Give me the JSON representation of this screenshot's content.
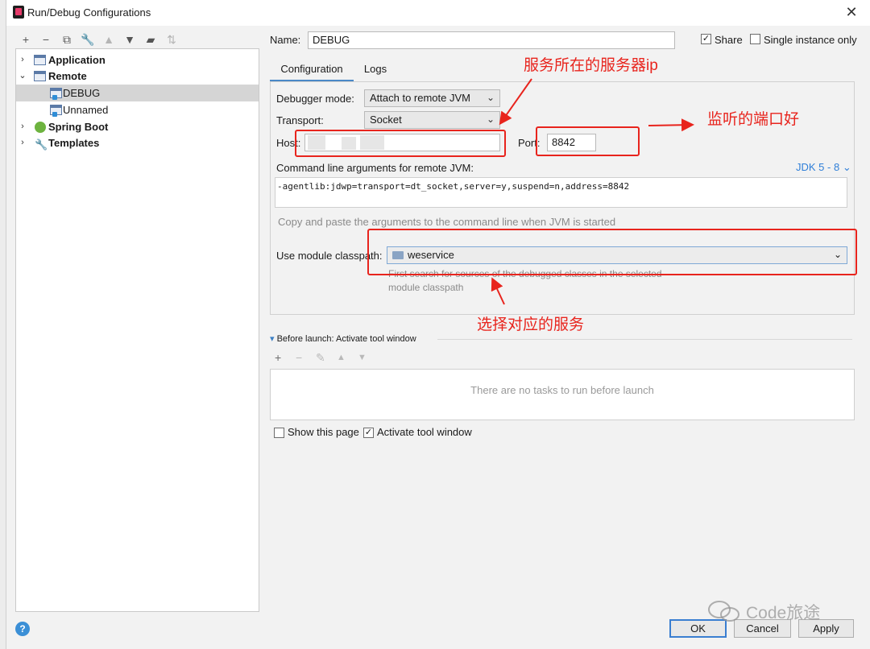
{
  "window": {
    "title": "Run/Debug Configurations",
    "close_symbol": "✕"
  },
  "toolbar": {
    "icons": [
      "add-icon",
      "remove-icon",
      "copy-icon",
      "wrench-icon",
      "move-up-icon",
      "move-down-icon",
      "new-folder-icon",
      "sort-icon"
    ]
  },
  "tree": {
    "items": [
      {
        "label": "Application",
        "bold": true
      },
      {
        "label": "Remote",
        "bold": true
      },
      {
        "label": "DEBUG",
        "bold": false,
        "selected": true
      },
      {
        "label": "Unnamed",
        "bold": false
      },
      {
        "label": "Spring Boot",
        "bold": true
      },
      {
        "label": "Templates",
        "bold": true
      }
    ]
  },
  "header": {
    "name_label": "Name:",
    "name_value": "DEBUG",
    "share_label": "Share",
    "share_checked": true,
    "single_instance_label": "Single instance only",
    "single_instance_checked": false
  },
  "tabs": [
    {
      "label": "Configuration",
      "active": true
    },
    {
      "label": "Logs",
      "active": false
    }
  ],
  "config": {
    "debugger_mode_label": "Debugger mode:",
    "debugger_mode_value": "Attach to remote JVM",
    "transport_label": "Transport:",
    "transport_value": "Socket",
    "host_label": "Host:",
    "host_value": "",
    "port_label": "Port:",
    "port_value": "8842",
    "cmd_label": "Command line arguments for remote JVM:",
    "jdk_link": "JDK 5 - 8",
    "cmd_value": "-agentlib:jdwp=transport=dt_socket,server=y,suspend=n,address=8842",
    "cmd_hint": "Copy and paste the arguments to the command line when JVM is started",
    "module_label": "Use module classpath:",
    "module_value": "weservice",
    "module_hint_1": "First search for sources of the debugged classes in the selected",
    "module_hint_2": "module classpath"
  },
  "before_launch": {
    "title": "Before launch: Activate tool window",
    "empty_text": "There are no tasks to run before launch"
  },
  "footer": {
    "show_page_label": "Show this page",
    "show_page_checked": false,
    "activate_label": "Activate tool window",
    "activate_checked": true,
    "ok": "OK",
    "cancel": "Cancel",
    "apply": "Apply",
    "help": "?"
  },
  "annotations": {
    "server_ip": "服务所在的服务器ip",
    "port": "监听的端口好",
    "service": "选择对应的服务",
    "color": "#e8241d"
  },
  "watermark": {
    "text": "Code旅途"
  }
}
